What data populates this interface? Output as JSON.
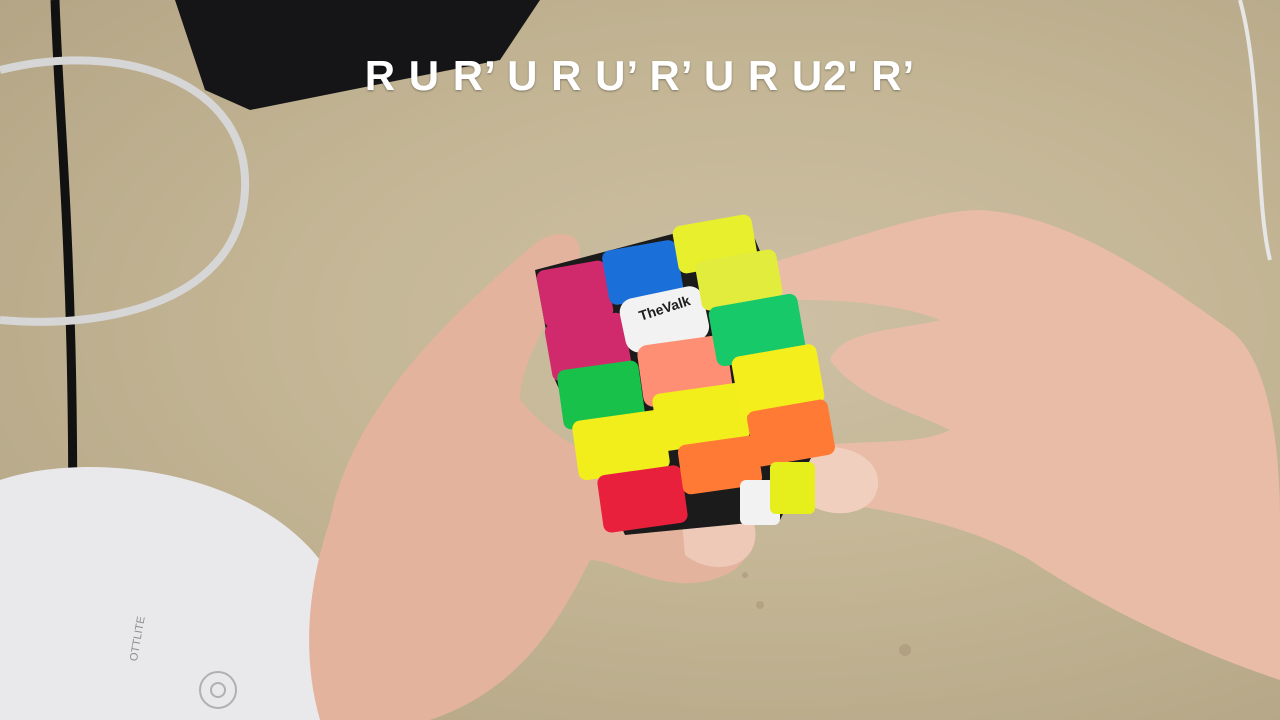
{
  "caption": {
    "algorithm": "R U R’ U R U’ R’ U R U2' R’"
  },
  "cube": {
    "logo_text": "TheValk"
  },
  "lamp": {
    "brand_text": "OTTLITE"
  },
  "colors": {
    "table": "#c2b594",
    "skin": "#e7b9a3",
    "sticker_red": "#e9203b",
    "sticker_magenta": "#d12a6c",
    "sticker_blue": "#1a6fd8",
    "sticker_yellow": "#f1ee1c",
    "sticker_green": "#18c24a",
    "sticker_orange": "#ff7a34",
    "sticker_peach": "#ff8f74",
    "sticker_white": "#f2f2f2"
  }
}
